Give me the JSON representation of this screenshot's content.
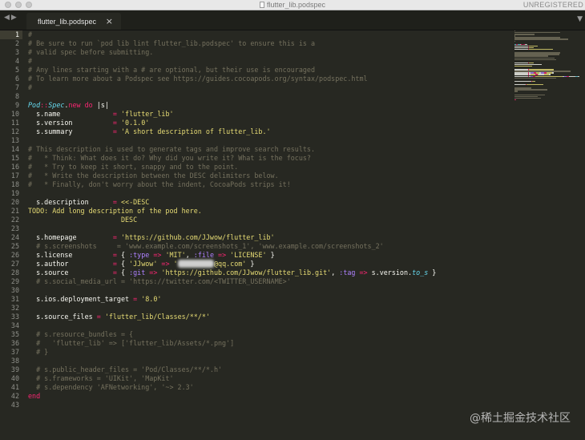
{
  "window": {
    "title": "flutter_lib.podspec",
    "registration": "UNREGISTERED"
  },
  "tabs": [
    {
      "label": "flutter_lib.podspec",
      "close": "×"
    }
  ],
  "editor": {
    "lines": [
      [
        [
          "#",
          "comment"
        ]
      ],
      [
        [
          "# Be sure to run `pod lib lint flutter_lib.podspec' to ensure this is a",
          "comment"
        ]
      ],
      [
        [
          "# valid spec before submitting.",
          "comment"
        ]
      ],
      [
        [
          "#",
          "comment"
        ]
      ],
      [
        [
          "# Any lines starting with a # are optional, but their use is encouraged",
          "comment"
        ]
      ],
      [
        [
          "# To learn more about a Podspec see https://guides.cocoapods.org/syntax/podspec.html",
          "comment"
        ]
      ],
      [
        [
          "#",
          "comment"
        ]
      ],
      [],
      [
        [
          "Pod",
          "type"
        ],
        [
          "::",
          "keyword"
        ],
        [
          "Spec",
          "type"
        ],
        [
          ".",
          "plain"
        ],
        [
          "new",
          "keyword"
        ],
        [
          " ",
          "plain"
        ],
        [
          "do",
          "keyword"
        ],
        [
          " |",
          "plain"
        ],
        [
          "s",
          "plain"
        ],
        [
          "|",
          "plain"
        ]
      ],
      [
        [
          "  s.name             ",
          "plain"
        ],
        [
          "= ",
          "keyword"
        ],
        [
          "'flutter_lib'",
          "string"
        ]
      ],
      [
        [
          "  s.version          ",
          "plain"
        ],
        [
          "= ",
          "keyword"
        ],
        [
          "'0.1.0'",
          "string"
        ]
      ],
      [
        [
          "  s.summary          ",
          "plain"
        ],
        [
          "= ",
          "keyword"
        ],
        [
          "'A short description of flutter_lib.'",
          "string"
        ]
      ],
      [],
      [
        [
          "# This description is used to generate tags and improve search results.",
          "comment"
        ]
      ],
      [
        [
          "#   * Think: What does it do? Why did you write it? What is the focus?",
          "comment"
        ]
      ],
      [
        [
          "#   * Try to keep it short, snappy and to the point.",
          "comment"
        ]
      ],
      [
        [
          "#   * Write the description between the DESC delimiters below.",
          "comment"
        ]
      ],
      [
        [
          "#   * Finally, don't worry about the indent, CocoaPods strips it!",
          "comment"
        ]
      ],
      [],
      [
        [
          "  s.description      ",
          "plain"
        ],
        [
          "= ",
          "keyword"
        ],
        [
          "<<-DESC",
          "string"
        ]
      ],
      [
        [
          "TODO: Add long description of the pod here.",
          "todo"
        ]
      ],
      [
        [
          "                       DESC",
          "string"
        ]
      ],
      [],
      [
        [
          "  s.homepage         ",
          "plain"
        ],
        [
          "= ",
          "keyword"
        ],
        [
          "'https://github.com/JJwow/flutter_lib'",
          "string"
        ]
      ],
      [
        [
          "  # s.screenshots     = 'www.example.com/screenshots_1', 'www.example.com/screenshots_2'",
          "comment"
        ]
      ],
      [
        [
          "  s.license          ",
          "plain"
        ],
        [
          "= ",
          "keyword"
        ],
        [
          "{ ",
          "plain"
        ],
        [
          ":type",
          "symbol"
        ],
        [
          " => ",
          "keyword"
        ],
        [
          "'MIT'",
          "string"
        ],
        [
          ", ",
          "plain"
        ],
        [
          ":file",
          "symbol"
        ],
        [
          " => ",
          "keyword"
        ],
        [
          "'LICENSE'",
          "string"
        ],
        [
          " }",
          "plain"
        ]
      ],
      [
        [
          "  s.author           ",
          "plain"
        ],
        [
          "= ",
          "keyword"
        ],
        [
          "{ ",
          "plain"
        ],
        [
          "'JJwow'",
          "string"
        ],
        [
          " => ",
          "keyword"
        ],
        [
          "'",
          "string"
        ],
        [
          "xxxxxxxxx",
          "blur"
        ],
        [
          "@qq.com'",
          "string"
        ],
        [
          " }",
          "plain"
        ]
      ],
      [
        [
          "  s.source           ",
          "plain"
        ],
        [
          "= ",
          "keyword"
        ],
        [
          "{ ",
          "plain"
        ],
        [
          ":git",
          "symbol"
        ],
        [
          " => ",
          "keyword"
        ],
        [
          "'https://github.com/JJwow/flutter_lib.git'",
          "string"
        ],
        [
          ", ",
          "plain"
        ],
        [
          ":tag",
          "symbol"
        ],
        [
          " => ",
          "keyword"
        ],
        [
          "s.version.",
          "plain"
        ],
        [
          "to_s",
          "type"
        ],
        [
          " }",
          "plain"
        ]
      ],
      [
        [
          "  # s.social_media_url = 'https://twitter.com/<TWITTER_USERNAME>'",
          "comment"
        ]
      ],
      [],
      [
        [
          "  s.ios.deployment_target ",
          "plain"
        ],
        [
          "= ",
          "keyword"
        ],
        [
          "'8.0'",
          "string"
        ]
      ],
      [],
      [
        [
          "  s.source_files ",
          "plain"
        ],
        [
          "= ",
          "keyword"
        ],
        [
          "'flutter_lib/Classes/**/*'",
          "string"
        ]
      ],
      [],
      [
        [
          "  # s.resource_bundles = {",
          "comment"
        ]
      ],
      [
        [
          "  #   'flutter_lib' => ['flutter_lib/Assets/*.png']",
          "comment"
        ]
      ],
      [
        [
          "  # }",
          "comment"
        ]
      ],
      [],
      [
        [
          "  # s.public_header_files = 'Pod/Classes/**/*.h'",
          "comment"
        ]
      ],
      [
        [
          "  # s.frameworks = 'UIKit', 'MapKit'",
          "comment"
        ]
      ],
      [
        [
          "  # s.dependency 'AFNetworking', '~> 2.3'",
          "comment"
        ]
      ],
      [
        [
          "end",
          "keyword"
        ]
      ],
      []
    ],
    "active_line": 1
  },
  "colors": {
    "background": "#272822",
    "comment": "#75715e",
    "keyword": "#f92672",
    "string": "#e6db74",
    "type": "#66d9ef",
    "symbol": "#ae81ff",
    "plain": "#f8f8f2"
  },
  "icons": {
    "nav": "chevron-left-right-icon",
    "close": "close-icon",
    "dropdown": "triangle-down-icon",
    "file": "document-icon"
  },
  "watermark": "@稀土掘金技术社区"
}
